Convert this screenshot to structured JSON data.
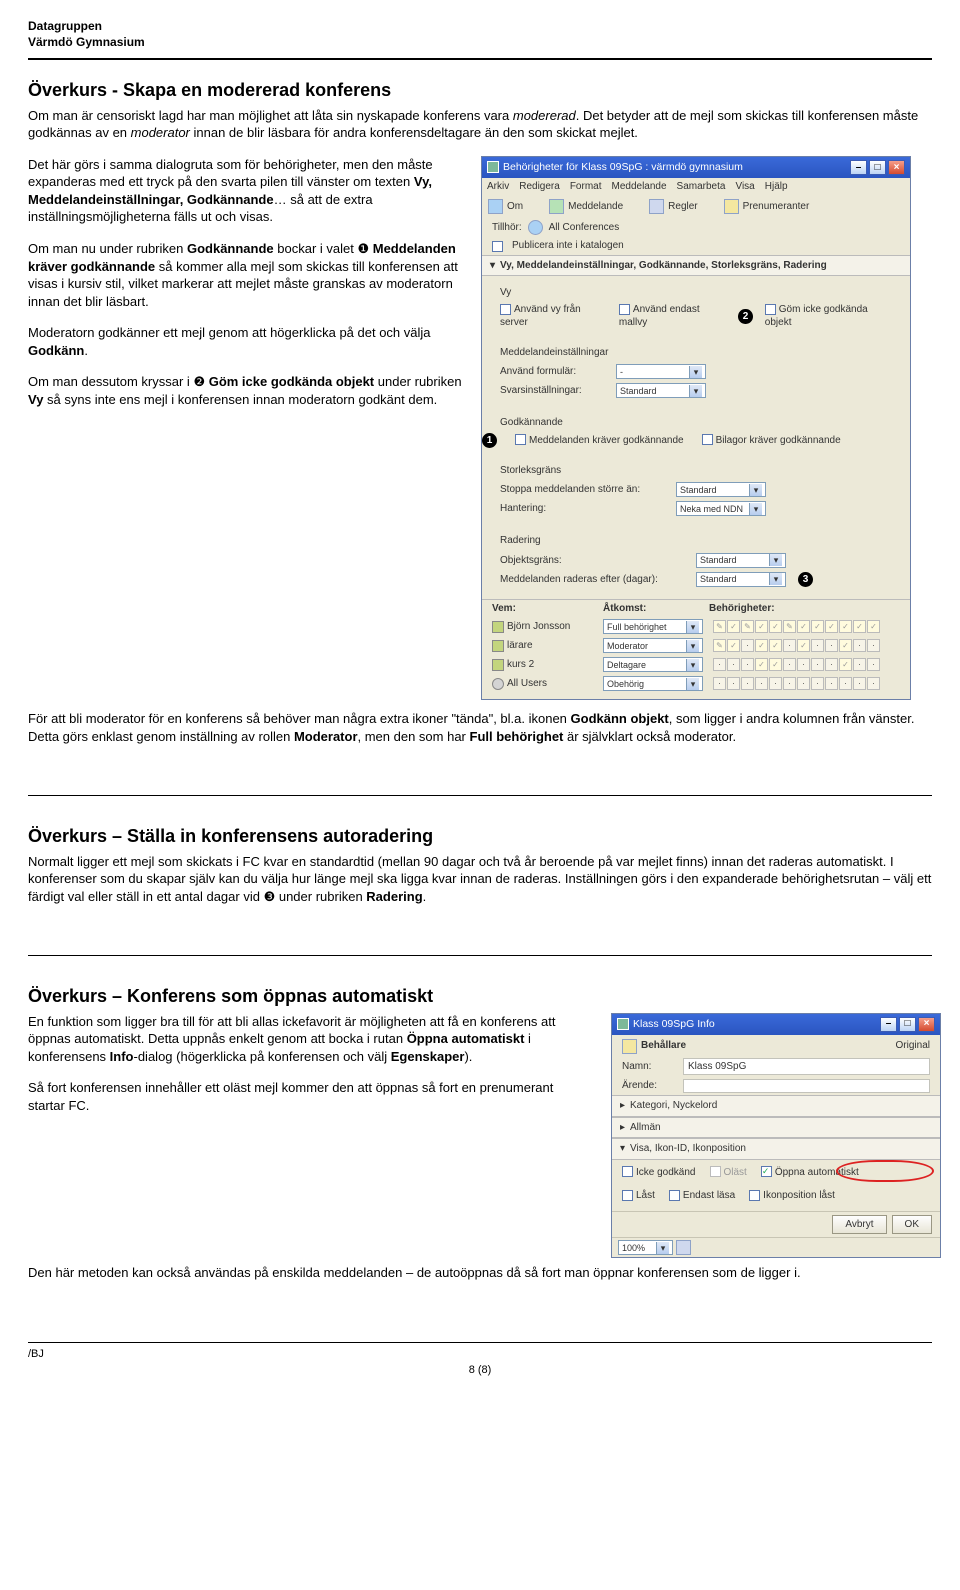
{
  "header": {
    "org1": "Datagruppen",
    "org2": "Värmdö Gymnasium"
  },
  "section1": {
    "title": "Överkurs - Skapa en modererad konferens",
    "p1_a": "Om man är censoriskt lagd har man möjlighet att låta sin nyskapade konferens vara ",
    "p1_em": "modererad",
    "p1_b": ". Det betyder att de mejl som skickas till konferensen måste godkännas av en ",
    "p1_em2": "moderator",
    "p1_c": " innan de blir läsbara för andra konferensdeltagare än den som skickat mejlet.",
    "p2_a": "Det här görs i samma dialogruta som för behörigheter, men den måste expanderas med ett tryck på den svarta pilen till vänster om texten ",
    "p2_b1": "Vy, Meddelandeinställningar, Godkännande",
    "p2_b": "… så att de extra inställningsmöjligheterna fälls ut och visas.",
    "p3_a": "Om man nu under rubriken ",
    "p3_b1": "Godkännande",
    "p3_b": " bockar i valet ",
    "p3_n": "❶",
    "p3_b2": " Meddelanden kräver godkännande",
    "p3_c": " så kommer alla mejl som skickas till konferensen att visas i kursiv stil, vilket markerar att mejlet måste granskas av moderatorn innan det blir läsbart.",
    "p4_a": "Moderatorn godkänner ett mejl genom att högerklicka på det och välja ",
    "p4_b1": "Godkänn",
    "p4_b": ".",
    "p5_a": "Om man dessutom kryssar i ",
    "p5_n": "❷",
    "p5_b1": " Göm icke godkända objekt",
    "p5_b": " under rubriken ",
    "p5_b2": "Vy",
    "p5_c": " så syns inte ens mejl i konferensen innan moderatorn godkänt dem.",
    "p6_a": "För att bli moderator för en konferens så behöver man några extra ikoner \"tända\", bl.a. ikonen ",
    "p6_b1": "Godkänn objekt",
    "p6_b": ", som ligger i andra kolumnen från vänster. Detta görs enklast genom inställning av rollen ",
    "p6_b2": "Moderator",
    "p6_c": ", men den som har ",
    "p6_b3": "Full behörighet",
    "p6_d": " är självklart också moderator."
  },
  "dialog1": {
    "title": "Behörigheter för Klass 09SpG : värmdö gymnasium",
    "menu": [
      "Arkiv",
      "Redigera",
      "Format",
      "Meddelande",
      "Samarbeta",
      "Visa",
      "Hjälp"
    ],
    "tabs": [
      "Om",
      "Meddelande",
      "Regler",
      "Prenumeranter"
    ],
    "tillhor_label": "Tillhör:",
    "tillhor_value": "All Conferences",
    "pub": "Publicera inte i katalogen",
    "expander": "Vy, Meddelandeinställningar, Godkännande, Storleksgräns, Radering",
    "vy_title": "Vy",
    "vy_a": "Använd vy från server",
    "vy_b": "Använd endast mallvy",
    "vy_c": "Göm icke godkända objekt",
    "mi_title": "Meddelandeinställningar",
    "mi_form_label": "Använd formulär:",
    "mi_form_value": "-",
    "mi_svar_label": "Svarsinställningar:",
    "mi_svar_value": "Standard",
    "gk_title": "Godkännande",
    "gk_a": "Meddelanden kräver godkännande",
    "gk_b": "Bilagor kräver godkännande",
    "sg_title": "Storleksgräns",
    "sg_label": "Stoppa meddelanden större än:",
    "sg_value": "Standard",
    "sg_han_label": "Hantering:",
    "sg_han_value": "Neka med NDN",
    "rad_title": "Radering",
    "rad_obj_label": "Objektsgräns:",
    "rad_obj_value": "Standard",
    "rad_days_label": "Meddelanden raderas efter (dagar):",
    "rad_days_value": "Standard",
    "cols": [
      "Vem:",
      "Åtkomst:",
      "Behörigheter:"
    ],
    "users": [
      {
        "name": "Björn Jonsson",
        "role": "Full behörighet"
      },
      {
        "name": "lärare",
        "role": "Moderator"
      },
      {
        "name": "kurs 2",
        "role": "Deltagare"
      },
      {
        "name": "All Users",
        "role": "Obehörig"
      }
    ]
  },
  "section2": {
    "title": "Överkurs – Ställa in konferensens autoradering",
    "p1_a": "Normalt ligger ett mejl som skickats i FC kvar en standardtid (mellan 90 dagar och två år beroende på var mejlet finns) innan det raderas automatiskt. I konferenser som du skapar själv kan du välja hur länge mejl ska ligga kvar innan de raderas. Inställningen görs i den expanderade behörighetsrutan – välj ett färdigt val eller ställ in ett antal dagar vid ",
    "p1_n": "❸",
    "p1_b": " under rubriken ",
    "p1_b1": "Radering",
    "p1_c": "."
  },
  "section3": {
    "title": "Överkurs – Konferens som öppnas automatiskt",
    "p1_a": "En funktion som ligger bra till för att bli allas ickefavorit är möjligheten att få en konferens att öppnas automatiskt. Detta uppnås enkelt genom att bocka i rutan ",
    "p1_b1": "Öppna automatiskt",
    "p1_b": " i konferensens ",
    "p1_b2": "Info",
    "p1_c": "-dialog (högerklicka på konferensen och välj ",
    "p1_b3": "Egenskaper",
    "p1_d": ").",
    "p2": "Så fort konferensen innehåller ett oläst mejl kommer den att öppnas så fort en prenumerant startar FC.",
    "p3": "Den här metoden kan också användas på enskilda meddelanden – de autoöppnas då så fort man öppnar konferensen som de ligger i."
  },
  "dialog2": {
    "title": "Klass 09SpG Info",
    "row1_label": "Behållare",
    "row1_right": "Original",
    "row2_label": "Namn:",
    "row2_value": "Klass 09SpG",
    "row3_label": "Ärende:",
    "exp1": "Kategori, Nyckelord",
    "exp2": "Allmän",
    "exp3": "Visa, Ikon-ID, Ikonposition",
    "c1": "Icke godkänd",
    "c2": "Oläst",
    "c3": "Öppna automatiskt",
    "c4": "Låst",
    "c5": "Endast läsa",
    "c6": "Ikonposition låst",
    "btn1": "Avbryt",
    "btn2": "OK",
    "zoom": "100%"
  },
  "footer": {
    "sig": "/BJ",
    "page": "8 (8)"
  }
}
